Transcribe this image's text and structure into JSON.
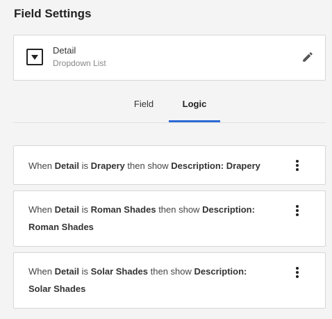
{
  "title": "Field Settings",
  "field": {
    "name": "Detail",
    "type": "Dropdown List",
    "icon": "dropdown-icon",
    "edit_icon": "pencil-icon"
  },
  "tabs": [
    {
      "label": "Field",
      "active": false
    },
    {
      "label": "Logic",
      "active": true
    }
  ],
  "accent_color": "#2e6bd6",
  "rules": [
    {
      "when": "When",
      "field": "Detail",
      "is": "is",
      "value": "Drapery",
      "then": "then show",
      "target": "Description: Drapery",
      "target_line2": ""
    },
    {
      "when": "When",
      "field": "Detail",
      "is": "is",
      "value": "Roman Shades",
      "then": "then show",
      "target": "Description:",
      "target_line2": "Roman Shades"
    },
    {
      "when": "When",
      "field": "Detail",
      "is": "is",
      "value": "Solar Shades",
      "then": "then show",
      "target": "Description:",
      "target_line2": "Solar Shades"
    }
  ]
}
